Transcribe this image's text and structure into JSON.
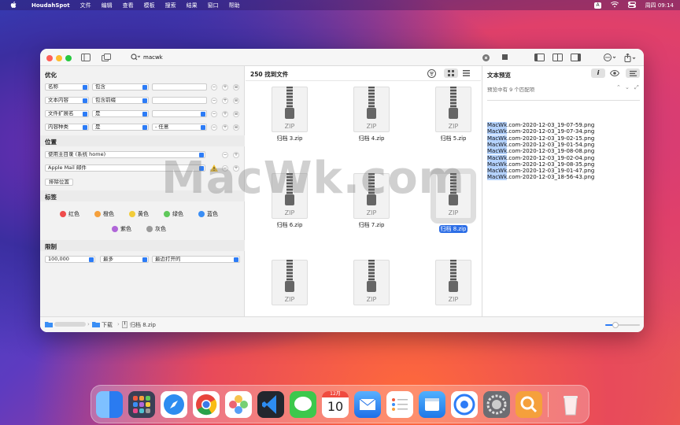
{
  "menubar": {
    "app": "HoudahSpot",
    "items": [
      "文件",
      "编辑",
      "查看",
      "模板",
      "搜索",
      "结果",
      "窗口",
      "帮助"
    ],
    "input_method": "A",
    "datetime": "周四 09:14"
  },
  "toolbar": {
    "search_value": "macwk"
  },
  "left": {
    "refine": {
      "title": "优化",
      "rows": [
        {
          "attr": "名称",
          "op": "包含",
          "value": "",
          "value2": ""
        },
        {
          "attr": "文本内容",
          "op": "包含前缀",
          "value": "",
          "value2": ""
        },
        {
          "attr": "文件扩展名",
          "op": "是",
          "value": "",
          "value2": ""
        },
        {
          "attr": "内容种类",
          "op": "是",
          "value": "",
          "value2": "- 任意"
        }
      ]
    },
    "location": {
      "title": "位置",
      "items": [
        "使用主目录 (系统 home)",
        "Apple Mail 邮件"
      ],
      "exclude_label": "排除位置"
    },
    "tags": {
      "title": "标签",
      "items": [
        {
          "label": "红色",
          "color": "#ef4b4b"
        },
        {
          "label": "橙色",
          "color": "#f5a03c"
        },
        {
          "label": "黄色",
          "color": "#f2cc3a"
        },
        {
          "label": "绿色",
          "color": "#5fc85a"
        },
        {
          "label": "蓝色",
          "color": "#3a8ef5"
        },
        {
          "label": "紫色",
          "color": "#b066d8"
        },
        {
          "label": "灰色",
          "color": "#9a9a9a"
        }
      ]
    },
    "limit": {
      "title": "限制",
      "count": "100,000",
      "mode": "最多",
      "sort": "最近打开的"
    }
  },
  "results": {
    "header": "250 找到文件",
    "files": [
      "归档 3.zip",
      "归档 4.zip",
      "归档 5.zip",
      "归档 6.zip",
      "归档 7.zip",
      "归档 8.zip",
      "",
      "",
      ""
    ],
    "zip_text": "ZIP",
    "selected_index": 5
  },
  "preview": {
    "title": "文本预览",
    "match_info": "预览中有 9 个匹配项",
    "lines": [
      {
        "hl": "MacWk",
        "rest": ".com-2020-12-03_19-07-59.png"
      },
      {
        "hl": "MacWk",
        "rest": ".com-2020-12-03_19-07-34.png"
      },
      {
        "hl": "MacWk",
        "rest": ".com-2020-12-03_19-02-15.png"
      },
      {
        "hl": "MacWk",
        "rest": ".com-2020-12-03_19-01-54.png"
      },
      {
        "hl": "MacWk",
        "rest": ".com-2020-12-03_19-08-08.png"
      },
      {
        "hl": "MacWk",
        "rest": ".com-2020-12-03_19-02-04.png"
      },
      {
        "hl": "MacWk",
        "rest": ".com-2020-12-03_19-08-35.png"
      },
      {
        "hl": "MacWk",
        "rest": ".com-2020-12-03_19-01-47.png"
      },
      {
        "hl": "MacWk",
        "rest": ".com-2020-12-03_18-56-43.png"
      }
    ]
  },
  "statusbar": {
    "path": [
      "下载",
      "归档 8.zip"
    ],
    "zoom_fraction": 0.3
  },
  "watermark": "MacWk.com",
  "dock": {
    "calendar_month": "12月",
    "calendar_day": "10"
  }
}
